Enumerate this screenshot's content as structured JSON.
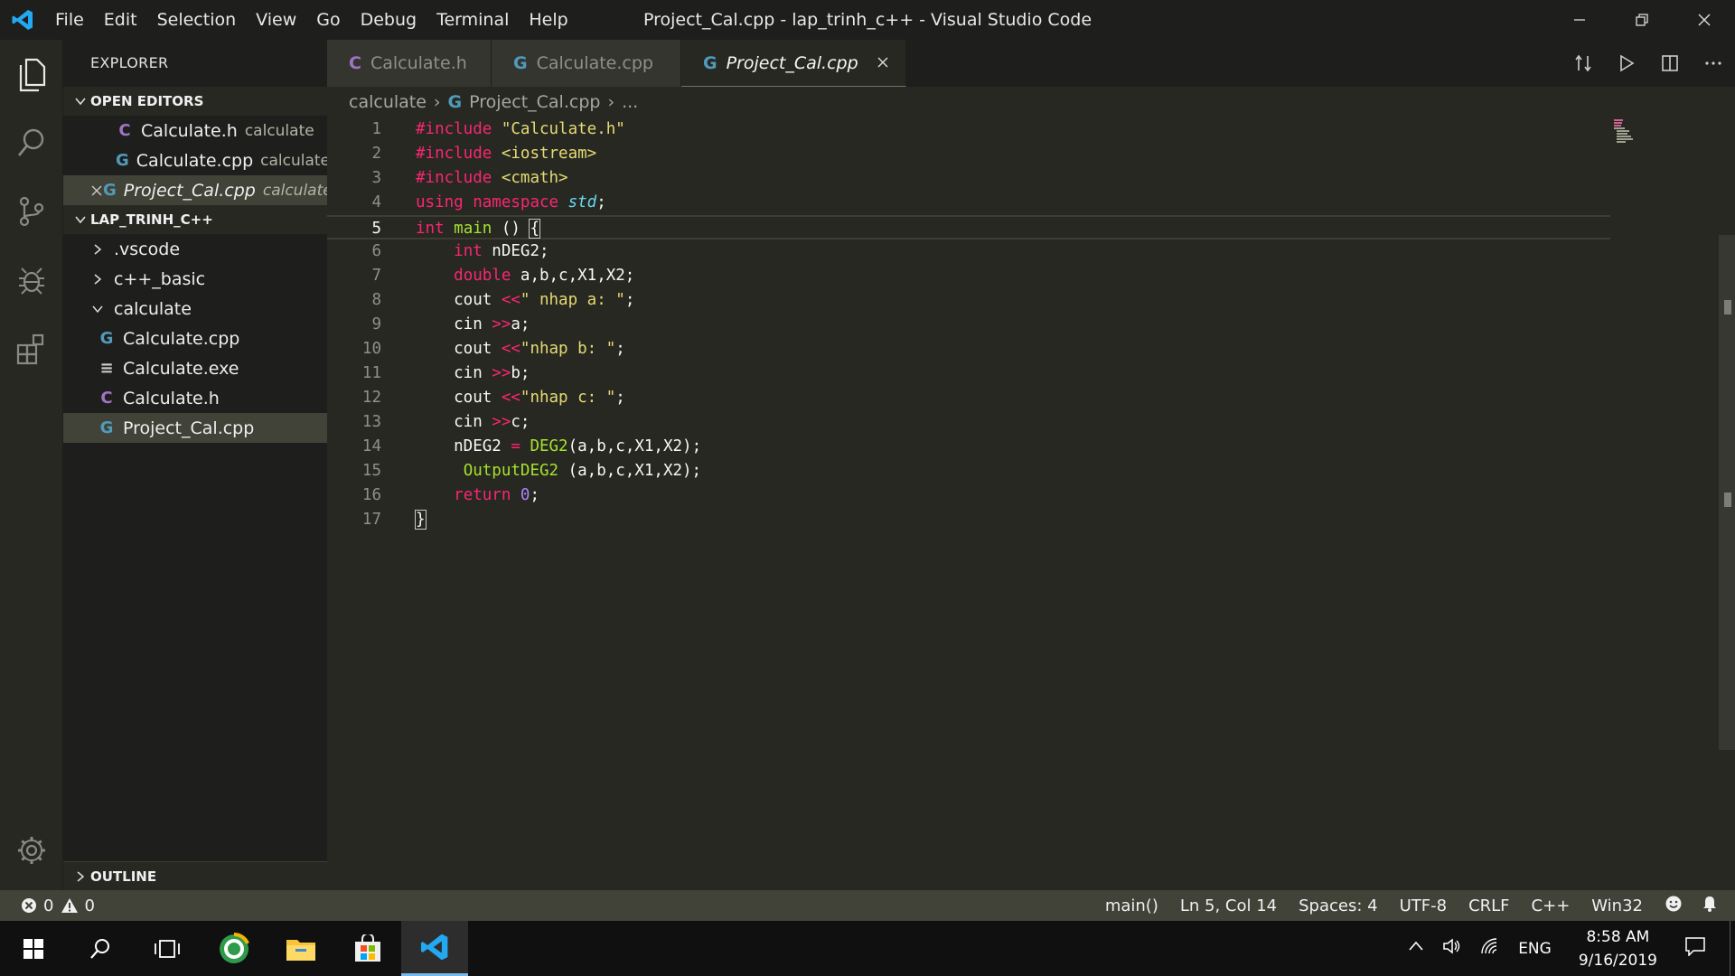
{
  "window": {
    "title": "Project_Cal.cpp - lap_trinh_c++ - Visual Studio Code"
  },
  "menu": [
    "File",
    "Edit",
    "Selection",
    "View",
    "Go",
    "Debug",
    "Terminal",
    "Help"
  ],
  "sidebar": {
    "title": "EXPLORER",
    "open_editors_label": "OPEN EDITORS",
    "open_editors": [
      {
        "name": "Calculate.h",
        "folder": "calculate",
        "icon": "c-header-icon"
      },
      {
        "name": "Calculate.cpp",
        "folder": "calculate",
        "icon": "cpp-file-icon"
      },
      {
        "name": "Project_Cal.cpp",
        "folder": "calculate",
        "icon": "cpp-file-icon"
      }
    ],
    "workspace_label": "LAP_TRINH_C++",
    "tree": [
      {
        "name": ".vscode"
      },
      {
        "name": "c++_basic"
      },
      {
        "name": "calculate"
      },
      {
        "name": "Calculate.cpp"
      },
      {
        "name": "Calculate.exe"
      },
      {
        "name": "Calculate.h"
      },
      {
        "name": "Project_Cal.cpp"
      }
    ],
    "outline_label": "OUTLINE"
  },
  "tabs": [
    {
      "label": "Calculate.h"
    },
    {
      "label": "Calculate.cpp"
    },
    {
      "label": "Project_Cal.cpp"
    }
  ],
  "breadcrumb": {
    "folder": "calculate",
    "file": "Project_Cal.cpp",
    "more": "..."
  },
  "editor": {
    "line_numbers": [
      "1",
      "2",
      "3",
      "4",
      "5",
      "6",
      "7",
      "8",
      "9",
      "10",
      "11",
      "12",
      "13",
      "14",
      "15",
      "16",
      "17"
    ]
  },
  "statusbar": {
    "errors": "0",
    "warnings": "0",
    "scope": "main()",
    "position": "Ln 5, Col 14",
    "spaces": "Spaces: 4",
    "encoding": "UTF-8",
    "eol": "CRLF",
    "language": "C++",
    "platform": "Win32"
  },
  "taskbar": {
    "language": "ENG",
    "time": "8:58 AM",
    "date": "9/16/2019"
  },
  "colors": {
    "accent": "#75715e",
    "keyword": "#f92672",
    "function": "#a6e22e",
    "string": "#e6db74",
    "number": "#ae81ff"
  }
}
